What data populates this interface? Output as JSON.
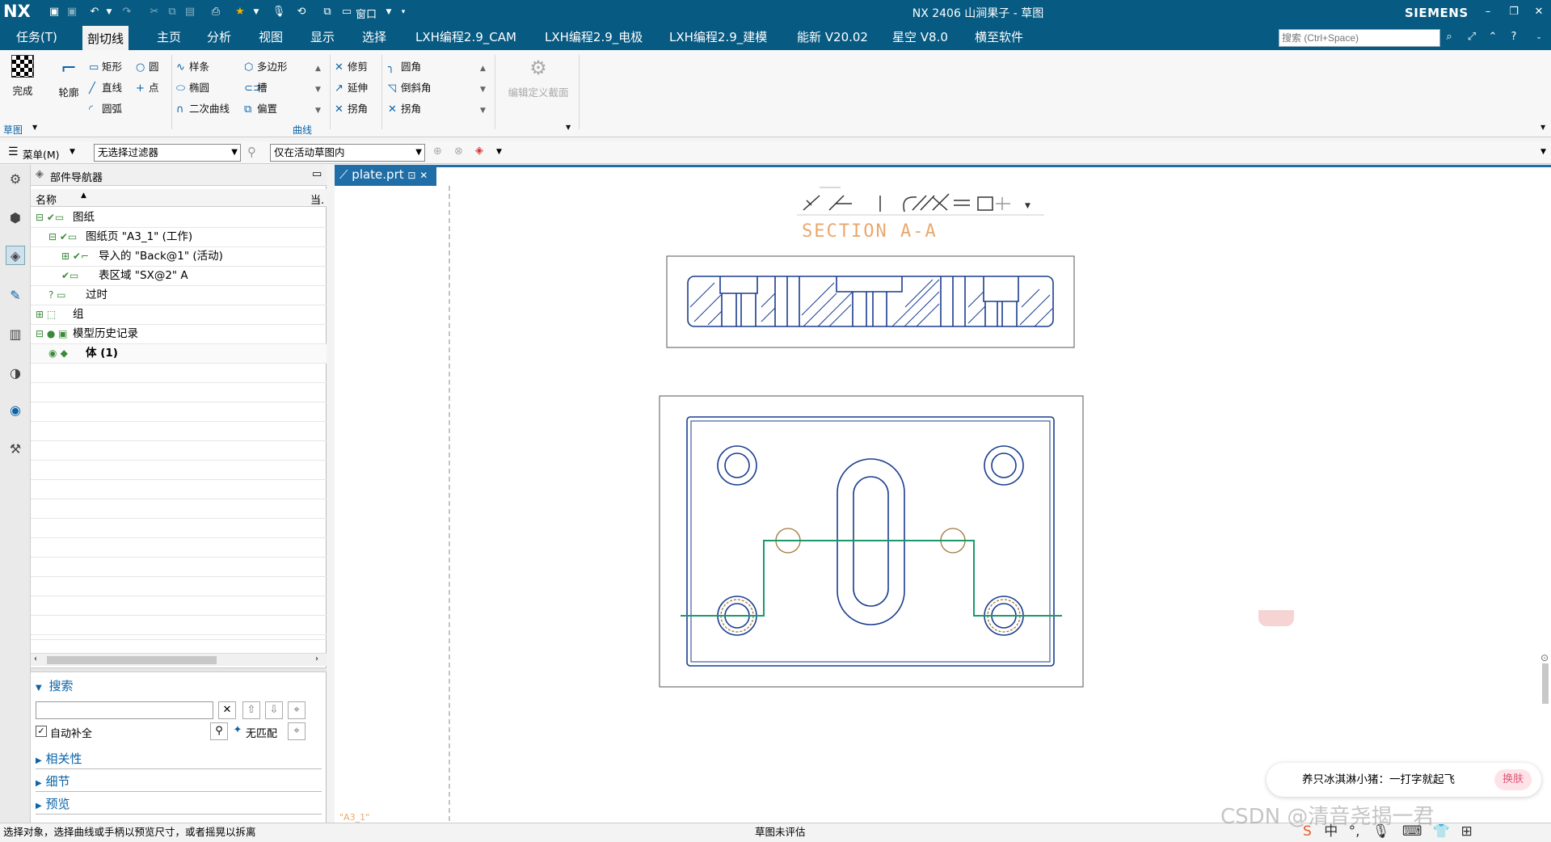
{
  "app": {
    "logo": "NX",
    "title": "NX 2406 山涧果子 - 草图",
    "brand": "SIEMENS",
    "window_menu": "窗口"
  },
  "menu": {
    "items": [
      "任务(T)",
      "剖切线",
      "主页",
      "分析",
      "视图",
      "显示",
      "选择",
      "LXH编程2.9_CAM",
      "LXH编程2.9_电极",
      "LXH编程2.9_建模",
      "能新 V20.02",
      "星空 V8.0",
      "横至软件"
    ],
    "active": "剖切线",
    "search_placeholder": "搜索 (Ctrl+Space)"
  },
  "ribbon": {
    "finish": "完成",
    "profile": "轮廓",
    "rect": "矩形",
    "circle": "圆",
    "line": "直线",
    "point": "点",
    "arc": "圆弧",
    "spline": "样条",
    "polygon": "多边形",
    "ellipse": "椭圆",
    "slot": "槽",
    "conic": "二次曲线",
    "offset": "偏置",
    "trim": "修剪",
    "extend": "延伸",
    "corner1": "拐角",
    "fillet": "圆角",
    "chamfer": "倒斜角",
    "corner2": "拐角",
    "edit_section": "编辑定义截面",
    "group_sketch": "草图",
    "group_curve": "曲线"
  },
  "filterbar": {
    "menu": "菜单(M)",
    "filter": "无选择过滤器",
    "scope": "仅在活动草图内"
  },
  "navigator": {
    "title": "部件导航器",
    "col_name": "名称",
    "col_cur": "当.",
    "rows": [
      {
        "label": "图纸",
        "indent": 0,
        "prefix": "⊟ ✔▭"
      },
      {
        "label": "图纸页 \"A3_1\" (工作)",
        "indent": 1,
        "prefix": "⊟ ✔▭"
      },
      {
        "label": "导入的 \"Back@1\" (活动)",
        "indent": 2,
        "prefix": "⊞ ✔⌐"
      },
      {
        "label": "表区域 \"SX@2\" A",
        "indent": 2,
        "prefix": "  ✔▭"
      },
      {
        "label": "过时",
        "indent": 1,
        "prefix": "? ▭"
      },
      {
        "label": "组",
        "indent": 0,
        "prefix": "⊞ ⬚"
      },
      {
        "label": "模型历史记录",
        "indent": 0,
        "prefix": "⊟ ● ▣"
      },
      {
        "label": "体 (1)",
        "indent": 1,
        "prefix": "◉ ◆"
      }
    ]
  },
  "search": {
    "title": "搜索",
    "auto_complete": "自动补全",
    "no_match": "无匹配",
    "sections": [
      "相关性",
      "细节",
      "预览"
    ]
  },
  "document": {
    "tab": "plate.prt",
    "section_label": "SECTION A-A",
    "sheet_label": "\"A3_1\""
  },
  "status": {
    "left": "选择对象，选择曲线或手柄以预览尺寸，或者摇晃以拆离",
    "center": "草图未评估"
  },
  "ime": {
    "text": "养只冰淇淋小猪：一打字就起飞",
    "button": "换肤",
    "watermark": "CSDN @清音尧揭一君"
  }
}
